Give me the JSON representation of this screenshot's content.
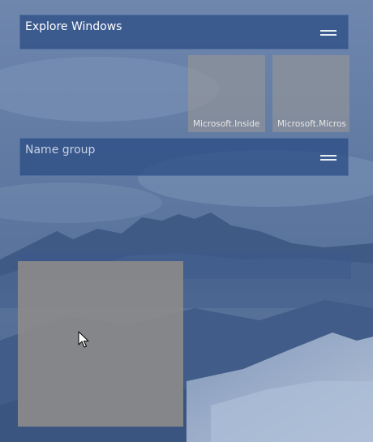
{
  "groups": [
    {
      "title": "Explore Windows"
    },
    {
      "title": "Name group"
    }
  ],
  "tiles": [
    {
      "label": "Microsoft.Inside"
    },
    {
      "label": "Microsoft.Micros"
    }
  ],
  "icons": {
    "group_handle": "grip-lines-icon",
    "cursor": "mouse-pointer-icon"
  },
  "colors": {
    "group_header_bg": "#284a82",
    "tile_bg": "#969696",
    "drag_tile_bg": "#8a8a8a"
  }
}
